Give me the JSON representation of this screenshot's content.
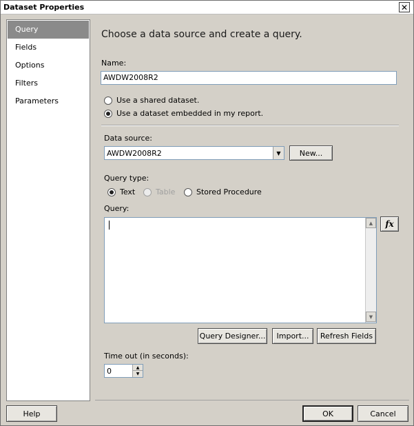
{
  "window": {
    "title": "Dataset Properties",
    "close_glyph": "✕"
  },
  "sidebar": {
    "items": [
      {
        "label": "Query",
        "active": true
      },
      {
        "label": "Fields",
        "active": false
      },
      {
        "label": "Options",
        "active": false
      },
      {
        "label": "Filters",
        "active": false
      },
      {
        "label": "Parameters",
        "active": false
      }
    ]
  },
  "main": {
    "heading": "Choose a data source and create a query.",
    "name_label": "Name:",
    "name_value": "AWDW2008R2",
    "dataset_options": [
      {
        "label": "Use a shared dataset.",
        "checked": false
      },
      {
        "label": "Use a dataset embedded in my report.",
        "checked": true
      }
    ],
    "data_source_label": "Data source:",
    "data_source_value": "AWDW2008R2",
    "new_button": "New...",
    "query_type_label": "Query type:",
    "query_types": [
      {
        "label": "Text",
        "checked": true,
        "enabled": true
      },
      {
        "label": "Table",
        "checked": false,
        "enabled": false
      },
      {
        "label": "Stored Procedure",
        "checked": false,
        "enabled": true
      }
    ],
    "query_label": "Query:",
    "query_value": "",
    "fx_button": "fx",
    "query_designer_button": "Query Designer...",
    "import_button": "Import...",
    "refresh_fields_button": "Refresh Fields",
    "timeout_label": "Time out (in seconds):",
    "timeout_value": "0"
  },
  "footer": {
    "help_button": "Help",
    "ok_button": "OK",
    "cancel_button": "Cancel"
  }
}
